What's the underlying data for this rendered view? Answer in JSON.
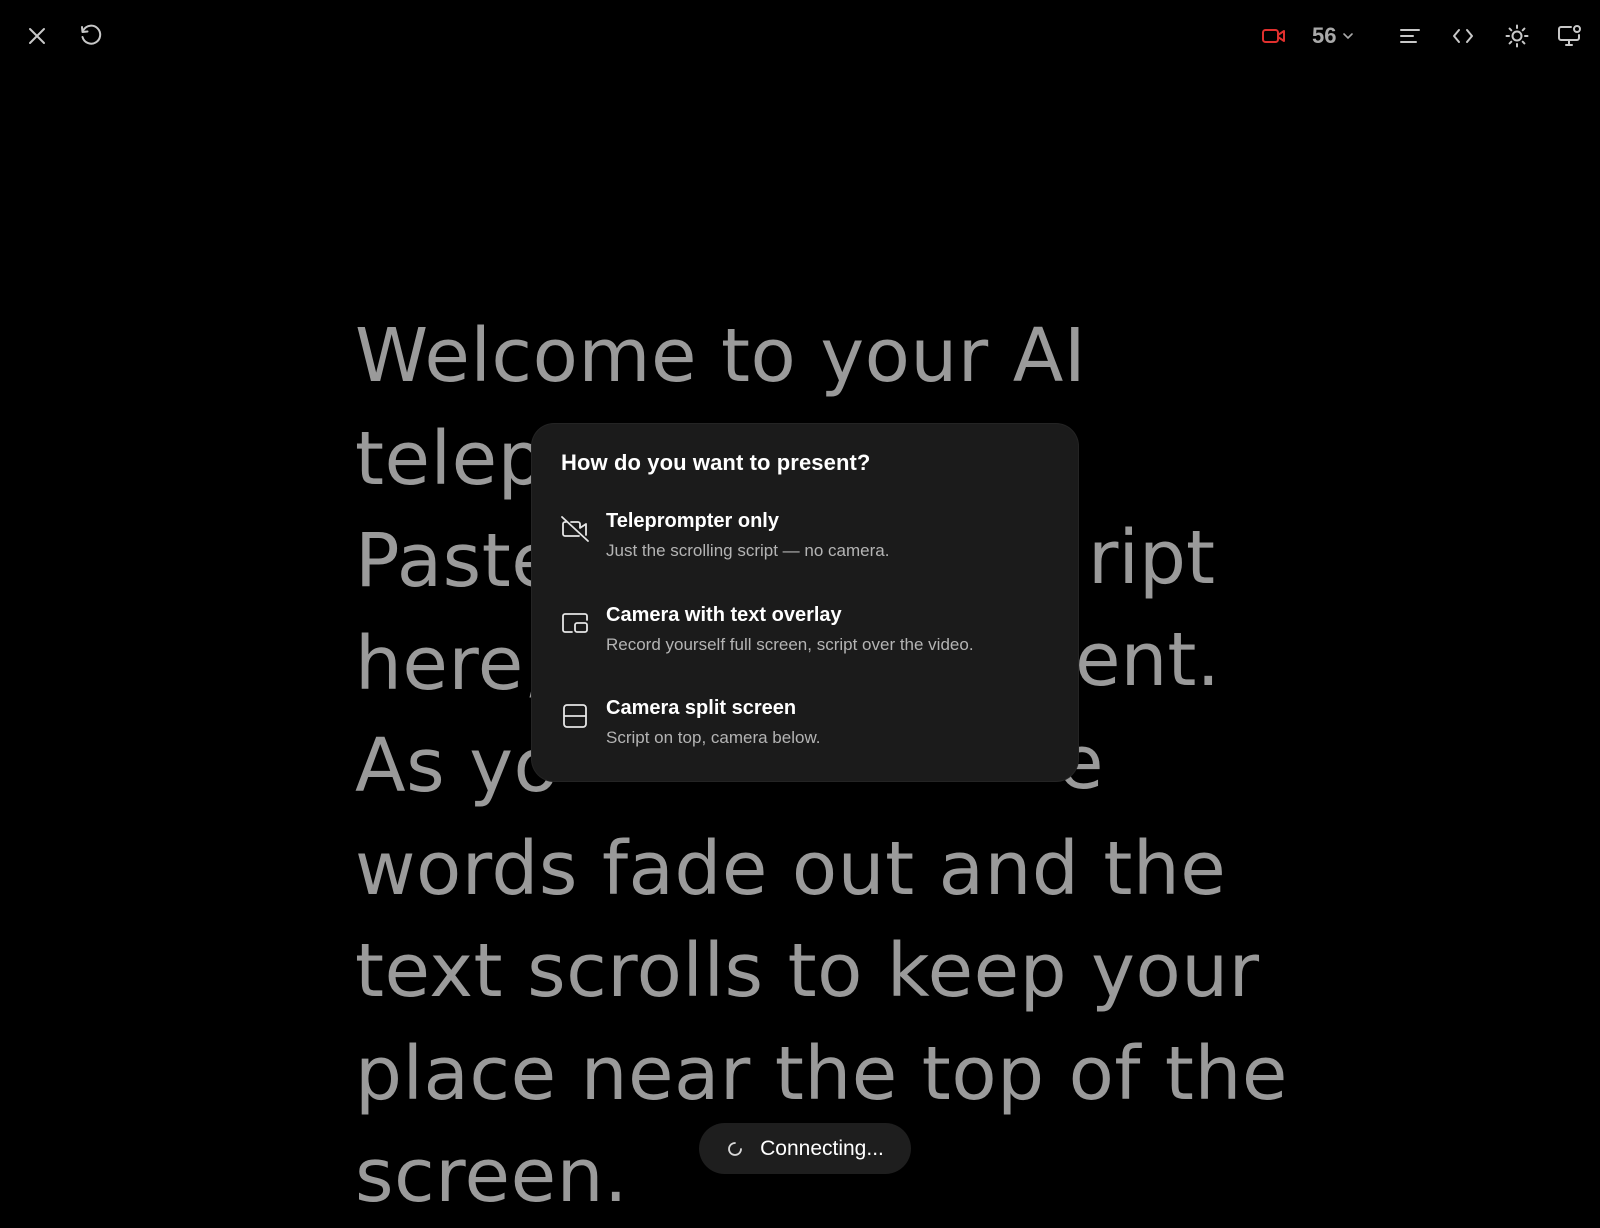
{
  "toolbar": {
    "font_size": "56",
    "icons": [
      "close-icon",
      "reset-icon",
      "camera-icon",
      "chevron-down-icon",
      "align-left-icon",
      "code-icon",
      "sun-icon",
      "monitor-icon"
    ],
    "record_color": "#e0302e"
  },
  "script": {
    "lines": [
      "Welcome to your AI",
      "telepr",
      "Paste",
      "here,",
      "As yo",
      "words fade out and the",
      "text scrolls to keep your",
      "place near the top of the",
      "screen."
    ],
    "right_fragments": [
      "ript",
      "ent.",
      "e"
    ]
  },
  "dialog": {
    "title": "How do you want to present?",
    "options": [
      {
        "title": "Teleprompter only",
        "description": "Just the scrolling script — no camera.",
        "icon": "video-off-icon"
      },
      {
        "title": "Camera with text overlay",
        "description": "Record yourself full screen, script over the video.",
        "icon": "picture-in-picture-icon"
      },
      {
        "title": "Camera split screen",
        "description": "Script on top, camera below.",
        "icon": "split-screen-icon"
      }
    ]
  },
  "status": {
    "text": "Connecting...",
    "icon": "spinner-icon"
  }
}
